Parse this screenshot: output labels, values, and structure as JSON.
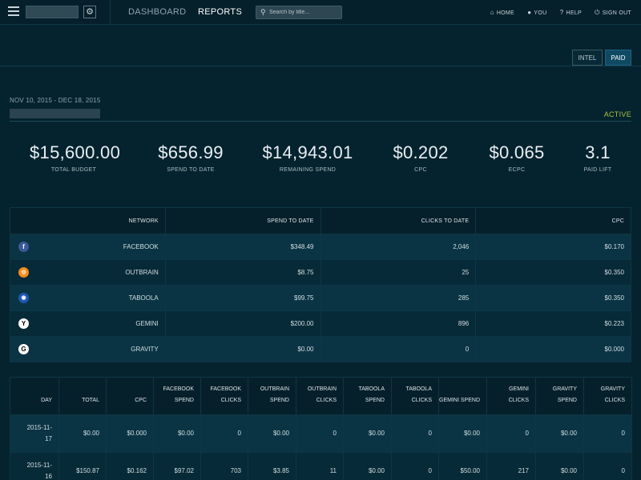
{
  "topbar": {
    "nav": {
      "dashboard": "DASHBOARD",
      "reports": "REPORTS"
    },
    "search_placeholder": "Search by title...",
    "links": {
      "home": "HOME",
      "you": "YOU",
      "help": "HELP",
      "signout": "SIGN OUT"
    }
  },
  "toggle": {
    "intel": "INTEL",
    "paid": "PAID"
  },
  "campaign": {
    "date_range": "NOV 10, 2015 - DEC 18, 2015",
    "status": "ACTIVE"
  },
  "metrics": [
    {
      "value": "$15,600.00",
      "label": "TOTAL BUDGET"
    },
    {
      "value": "$656.99",
      "label": "SPEND TO DATE"
    },
    {
      "value": "$14,943.01",
      "label": "REMAINING SPEND"
    },
    {
      "value": "$0.202",
      "label": "CPC"
    },
    {
      "value": "$0.065",
      "label": "ECPC"
    },
    {
      "value": "3.1",
      "label": "PAID LIFT"
    }
  ],
  "network_table": {
    "headers": [
      "NETWORK",
      "SPEND TO DATE",
      "CLICKS TO DATE",
      "CPC"
    ],
    "rows": [
      {
        "icon": "facebook-icon",
        "glyph": "f",
        "name": "FACEBOOK",
        "spend": "$348.49",
        "clicks": "2,046",
        "cpc": "$0.170"
      },
      {
        "icon": "outbrain-icon",
        "glyph": "◎",
        "name": "OUTBRAIN",
        "spend": "$8.75",
        "clicks": "25",
        "cpc": "$0.350"
      },
      {
        "icon": "taboola-icon",
        "glyph": "◉",
        "name": "TABOOLA",
        "spend": "$99.75",
        "clicks": "285",
        "cpc": "$0.350"
      },
      {
        "icon": "gemini-icon",
        "glyph": "Y",
        "name": "GEMINI",
        "spend": "$200.00",
        "clicks": "896",
        "cpc": "$0.223"
      },
      {
        "icon": "gravity-icon",
        "glyph": "G",
        "name": "GRAVITY",
        "spend": "$0.00",
        "clicks": "0",
        "cpc": "$0.000"
      }
    ]
  },
  "daily_table": {
    "headers": [
      [
        "DAY"
      ],
      [
        "TOTAL"
      ],
      [
        "CPC"
      ],
      [
        "FACEBOOK",
        "SPEND"
      ],
      [
        "FACEBOOK",
        "CLICKS"
      ],
      [
        "OUTBRAIN",
        "SPEND"
      ],
      [
        "OUTBRAIN",
        "CLICKS"
      ],
      [
        "TABOOLA",
        "SPEND"
      ],
      [
        "TABOOLA",
        "CLICKS"
      ],
      [
        "GEMINI SPEND"
      ],
      [
        "GEMINI CLICKS"
      ],
      [
        "GRAVITY",
        "SPEND"
      ],
      [
        "GRAVITY",
        "CLICKS"
      ]
    ],
    "rows": [
      {
        "day": [
          "2015-11-",
          "17"
        ],
        "cells": [
          "$0.00",
          "$0.000",
          "$0.00",
          "0",
          "$0.00",
          "0",
          "$0.00",
          "0",
          "$0.00",
          "0",
          "$0.00",
          "0"
        ]
      },
      {
        "day": [
          "2015-11-",
          "16"
        ],
        "cells": [
          "$150.87",
          "$0.162",
          "$97.02",
          "703",
          "$3.85",
          "11",
          "$0.00",
          "0",
          "$50.00",
          "217",
          "$0.00",
          "0"
        ]
      }
    ]
  }
}
